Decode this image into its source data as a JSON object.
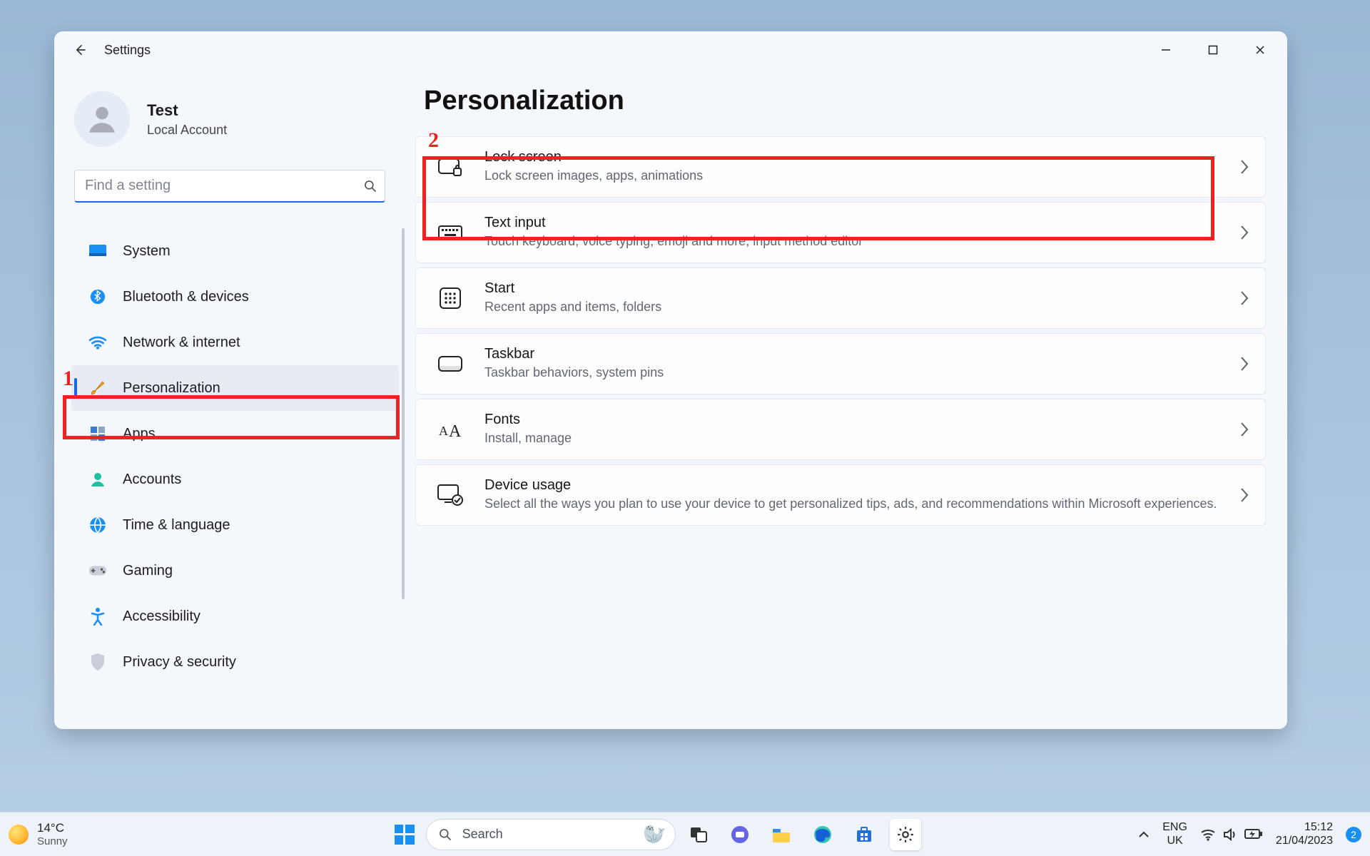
{
  "window": {
    "title": "Settings",
    "controls": {
      "minimize": "minimize",
      "maximize": "maximize",
      "close": "close"
    }
  },
  "profile": {
    "name": "Test",
    "subtitle": "Local Account"
  },
  "search": {
    "placeholder": "Find a setting"
  },
  "nav": [
    {
      "label": "System",
      "icon": "system"
    },
    {
      "label": "Bluetooth & devices",
      "icon": "bluetooth"
    },
    {
      "label": "Network & internet",
      "icon": "wifi"
    },
    {
      "label": "Personalization",
      "icon": "brush",
      "active": true
    },
    {
      "label": "Apps",
      "icon": "apps"
    },
    {
      "label": "Accounts",
      "icon": "account"
    },
    {
      "label": "Time & language",
      "icon": "timelang"
    },
    {
      "label": "Gaming",
      "icon": "gaming"
    },
    {
      "label": "Accessibility",
      "icon": "accessibility"
    },
    {
      "label": "Privacy & security",
      "icon": "privacy"
    }
  ],
  "page": {
    "title": "Personalization",
    "items": [
      {
        "title": "Lock screen",
        "desc": "Lock screen images, apps, animations",
        "icon": "lock"
      },
      {
        "title": "Text input",
        "desc": "Touch keyboard, voice typing, emoji and more, input method editor",
        "icon": "keyboard"
      },
      {
        "title": "Start",
        "desc": "Recent apps and items, folders",
        "icon": "startmenu"
      },
      {
        "title": "Taskbar",
        "desc": "Taskbar behaviors, system pins",
        "icon": "taskbar"
      },
      {
        "title": "Fonts",
        "desc": "Install, manage",
        "icon": "fonts"
      },
      {
        "title": "Device usage",
        "desc": "Select all the ways you plan to use your device to get personalized tips, ads, and recommendations within Microsoft experiences.",
        "icon": "deviceusage"
      }
    ]
  },
  "annotations": {
    "one": "1",
    "two": "2"
  },
  "taskbar": {
    "weather": {
      "temp": "14°C",
      "cond": "Sunny"
    },
    "search": "Search",
    "lang": {
      "top": "ENG",
      "bottom": "UK"
    },
    "clock": {
      "time": "15:12",
      "date": "21/04/2023"
    },
    "notifications": "2"
  }
}
